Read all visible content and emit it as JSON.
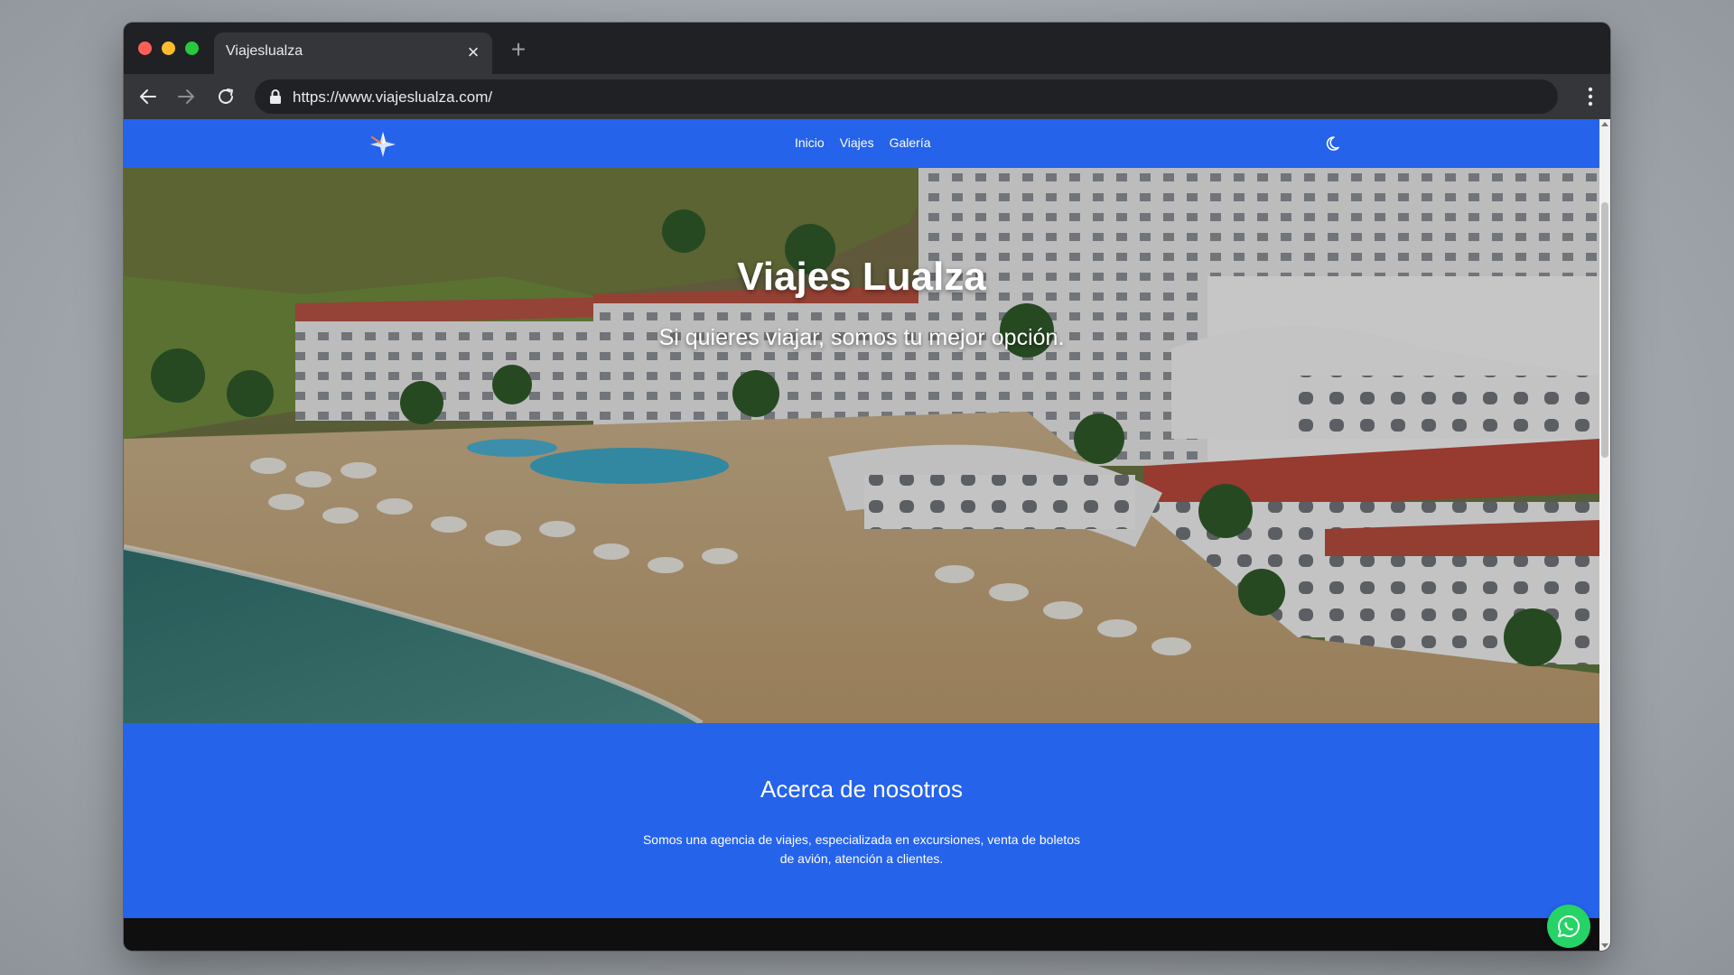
{
  "browser": {
    "tab_title": "Viajeslualza",
    "tab_close_icon": "close-icon",
    "new_tab_icon": "plus-icon",
    "url": "https://www.viajeslualza.com/"
  },
  "site": {
    "nav": {
      "logo_icon": "star-logo-icon",
      "links": [
        "Inicio",
        "Viajes",
        "Galería"
      ],
      "theme_toggle_icon": "moon-icon"
    },
    "hero": {
      "title": "Viajes Lualza",
      "subtitle": "Si quieres viajar, somos tu mejor opción."
    },
    "about": {
      "title": "Acerca de nosotros",
      "text": "Somos una agencia de viajes, especializada en excursiones, venta de boletos de avión, atención a clientes."
    },
    "whatsapp_icon": "whatsapp-icon"
  },
  "colors": {
    "brand_blue": "#2563eb",
    "whatsapp_green": "#25d366"
  }
}
